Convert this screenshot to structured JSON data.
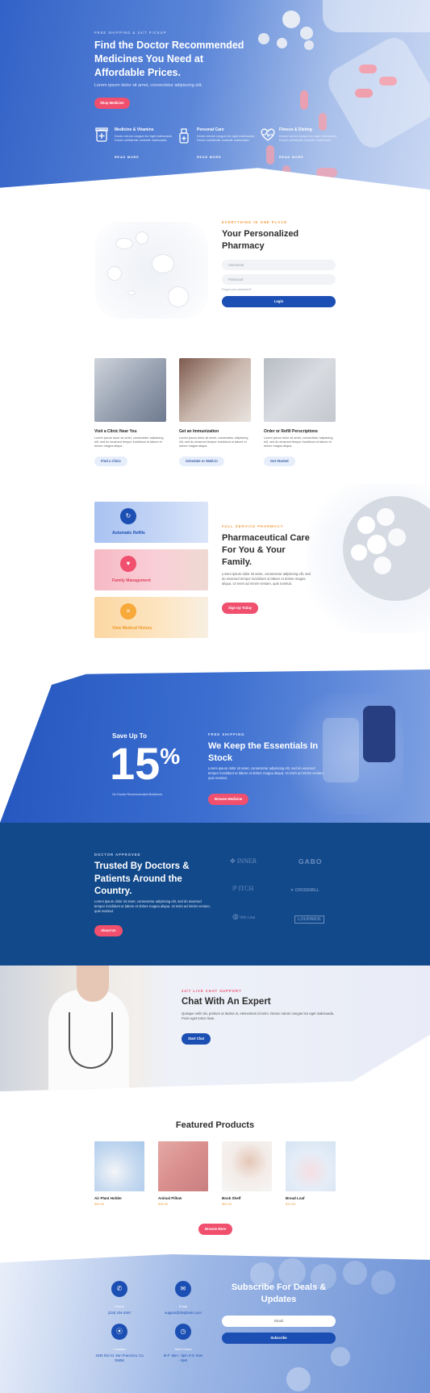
{
  "hero": {
    "kicker": "FREE SHIPPING & 24/7 PICKUP",
    "title": "Find the Doctor Recommended Medicines You Need at Affordable Prices.",
    "subtitle": "Lorem ipsum dolor sit amet, consectetur adipiscing elit.",
    "cta": "Shop Medicine",
    "features": [
      {
        "icon": "medicine-jar-icon",
        "title": "Medicine & Vitamins",
        "desc": "Donec rutrum congue leo eget malesuada. Donec sollicitudin molestie malesuada.",
        "more": "READ MORE"
      },
      {
        "icon": "spray-bottle-icon",
        "title": "Personal Care",
        "desc": "Donec rutrum congue leo eget malesuada. Donec sollicitudin molestie malesuada.",
        "more": "READ MORE"
      },
      {
        "icon": "heart-pulse-icon",
        "title": "Fitness & Dieting",
        "desc": "Donec rutrum congue leo eget malesuada. Donec sollicitudin molestie malesuada.",
        "more": "READ MORE"
      }
    ]
  },
  "pharmacy": {
    "kicker": "EVERYTHING IN ONE PLACE",
    "title": "Your Personalized Pharmacy",
    "username_placeholder": "Username",
    "password_placeholder": "Password",
    "forgot": "Forgot your password?",
    "login": "Login"
  },
  "services": [
    {
      "title": "Visit a Clinic Near You",
      "desc": "Lorem ipsum dolor sit amet, consectetur adipiscing elit, sed do eiusmod tempor incididunt ut labore et dolore magna aliqua.",
      "button": "Find a Clinic"
    },
    {
      "title": "Get an Immunization",
      "desc": "Lorem ipsum dolor sit amet, consectetur adipiscing elit, sed do eiusmod tempor incididunt ut labore et dolore magna aliqua.",
      "button": "Schedule or Walk-in"
    },
    {
      "title": "Order or Refill Perscriptions",
      "desc": "Lorem ipsum dolor sit amet, consectetur adipiscing elit, sed do eiusmod tempor incididunt ut labore et dolore magna aliqua.",
      "button": "Get Started"
    }
  ],
  "care": {
    "tiles": [
      {
        "label": "Automatic Refills",
        "icon": "refresh-icon",
        "color": "#1c4fb3"
      },
      {
        "label": "Family Management",
        "icon": "family-icon",
        "color": "#f0506e"
      },
      {
        "label": "View Medical History",
        "icon": "history-icon",
        "color": "#f7a93a"
      }
    ],
    "kicker": "FULL SERVICE PHARMACY",
    "title": "Pharmaceutical Care For You & Your Family.",
    "desc": "Lorem ipsum dolor sit amet, consectetur adipiscing elit, sed do eiusmod tempor incididunt ut labore et dolore magna aliqua. Ut enim ad minim veniam, quis nostrud.",
    "cta": "Sign Up Today"
  },
  "offer": {
    "save_label": "Save Up To",
    "percent": "15",
    "percent_sign": "%",
    "note": "On Doctor Recommended Medicines",
    "kicker": "FREE SHIPPING",
    "title": "We Keep the Essentials In Stock",
    "desc": "Lorem ipsum dolor sit amet, consectetur adipiscing elit, sed do eiusmod tempor incididunt ut labore et dolore magna aliqua. Ut enim ad minim veniam, quis nostrud.",
    "cta": "Browse Medicine"
  },
  "trust": {
    "kicker": "DOCTOR APPROVED",
    "title": "Trusted By Doctors & Patients Around the Country.",
    "desc": "Lorem ipsum dolor sit amet, consectetur adipiscing elit, sed do eiusmod tempor incididunt ut labore et dolore magna aliqua. Ut enim ad minim veniam, quis nostrud.",
    "cta": "About Us",
    "logos": [
      "INNER",
      "GABO",
      "ITCH",
      "CROSSWILL",
      "Info Line",
      "LOUDNICK"
    ]
  },
  "chat": {
    "kicker": "24/7 LIVE CHAT SUPPORT",
    "title": "Chat With An Expert",
    "desc": "Quisque velit nisi, pretium ut lacinia in, elementum id enim. Donec rutrum congue leo eget malesuada. Proin eget tortor risus.",
    "cta": "Start Chat"
  },
  "products": {
    "title": "Featured Products",
    "items": [
      {
        "name": "Air Plant Holder",
        "price": "$50.00"
      },
      {
        "name": "Animal Pillow",
        "price": "$35.00"
      },
      {
        "name": "Book Shelf",
        "price": "$60.00"
      },
      {
        "name": "Bread Loaf",
        "price": "$10.00"
      }
    ],
    "cta": "Browse More"
  },
  "footer": {
    "contacts": [
      {
        "icon": "phone-icon",
        "label": "Phone",
        "value": "(234) 234-3467"
      },
      {
        "icon": "email-icon",
        "label": "Email",
        "value": "support@divipharm.com"
      },
      {
        "icon": "location-icon",
        "label": "Location",
        "value": "1945 Divi St. San Francisco, Ca 39456"
      },
      {
        "icon": "clock-icon",
        "label": "Store Hours",
        "value": "M-F: 9am - 9pm S-S: 9am - 6pm"
      }
    ],
    "subscribe_title": "Subscribe For Deals & Updates",
    "email_placeholder": "Email",
    "subscribe_button": "Subscribe"
  },
  "colors": {
    "brand_blue": "#1c4fb3",
    "accent_pink": "#f0506e",
    "accent_orange": "#f29a3d",
    "navy": "#12498a"
  }
}
